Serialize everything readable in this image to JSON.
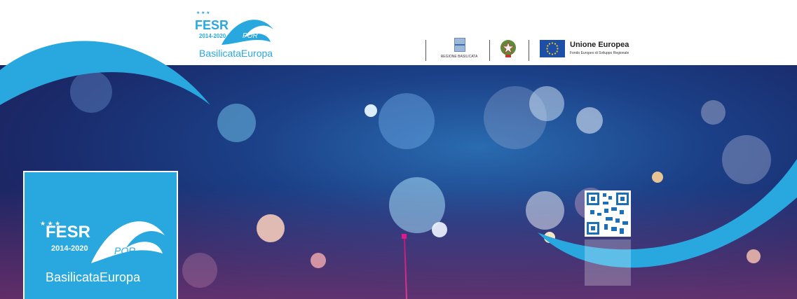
{
  "header": {
    "logo": {
      "fesr": "FESR",
      "years": "2014-2020",
      "por": "POR",
      "brand": "BasilicataEuropa"
    },
    "regione_label": "REGIONE BASILICATA",
    "eu_title": "Unione Europea",
    "eu_subtitle": "Fondo Europeo di Sviluppo Regionale"
  },
  "hero": {
    "box_logo": {
      "fesr": "FESR",
      "years": "2014-2020",
      "por": "POR",
      "brand": "BasilicataEuropa"
    }
  },
  "colors": {
    "brand_blue": "#29a8e0",
    "eu_blue": "#1e4fa8",
    "pin_magenta": "#e0198a"
  },
  "icons": [
    "regione-basilicata-emblem-icon",
    "italian-republic-emblem-icon",
    "eu-flag-icon",
    "qr-code-icon",
    "map-pin-icon"
  ]
}
